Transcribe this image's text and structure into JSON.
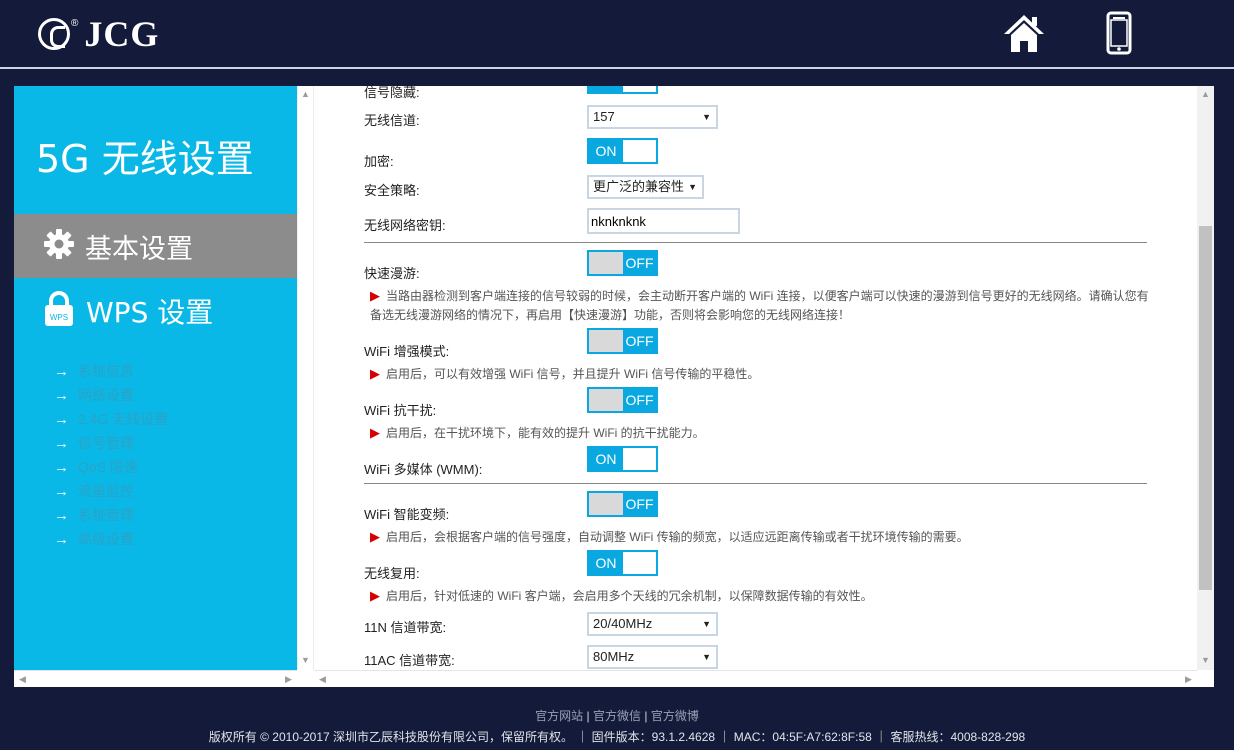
{
  "header": {
    "logo_text": "JCG",
    "logo_reg": "®",
    "home_icon": "home-icon",
    "mobile_icon": "mobile-phone-icon"
  },
  "sidebar": {
    "title": "5G 无线设置",
    "basic": {
      "label": "基本设置",
      "icon": "gear-icon"
    },
    "wps": {
      "label": "WPS 设置",
      "icon": "lock-icon",
      "icon_text": "WPS"
    },
    "links": [
      "系统信息",
      "网络设置",
      "2.4G 无线设置",
      "信号管理",
      "QoS 限速",
      "流量监控",
      "系统管理",
      "高级设置"
    ],
    "arrow": "→"
  },
  "content": {
    "partial_top_label": "信号隐藏:",
    "channel": {
      "label": "无线信道:",
      "value": "157"
    },
    "encrypt": {
      "label": "加密:",
      "state": "ON"
    },
    "security": {
      "label": "安全策略:",
      "value": "更广泛的兼容性"
    },
    "wifi_key": {
      "label": "无线网络密钥:",
      "value": "nknknknk"
    },
    "fast_roam": {
      "label": "快速漫游:",
      "state": "OFF",
      "note": "当路由器检测到客户端连接的信号较弱的时候，会主动断开客户端的 WiFi 连接，以便客户端可以快速的漫游到信号更好的无线网络。请确认您有备选无线漫游网络的情况下，再启用【快速漫游】功能，否则将会影响您的无线网络连接！"
    },
    "wifi_boost": {
      "label": "WiFi 增强模式:",
      "state": "OFF",
      "note": "启用后，可以有效增强 WiFi 信号，并且提升 WiFi 信号传输的平稳性。"
    },
    "wifi_anti": {
      "label": "WiFi 抗干扰:",
      "state": "OFF",
      "note": "启用后，在干扰环境下，能有效的提升 WiFi 的抗干扰能力。"
    },
    "wmm": {
      "label": "WiFi 多媒体 (WMM):",
      "state": "ON"
    },
    "smart_freq": {
      "label": "WiFi 智能变频:",
      "state": "OFF",
      "note": "启用后，会根据客户端的信号强度，自动调整 WiFi 传输的频宽，以适应远距离传输或者干扰环境传输的需要。"
    },
    "reuse": {
      "label": "无线复用:",
      "state": "ON",
      "note": "启用后，针对低速的 WiFi 客户端，会启用多个天线的冗余机制，以保障数据传输的有效性。"
    },
    "bw_11n": {
      "label": "11N 信道带宽:",
      "value": "20/40MHz"
    },
    "bw_11ac": {
      "label": "11AC 信道带宽:",
      "value": "80MHz"
    },
    "caret": "▼"
  },
  "footer": {
    "links": [
      "官方网站",
      "官方微信",
      "官方微博"
    ],
    "sep": "|",
    "copyright": "版权所有 © 2010-2017 深圳市乙辰科技股份有限公司，保留所有权。 ｜ 固件版本：93.1.2.4628 ｜ MAC：04:5F:A7:62:8F:58 ｜ 客服热线：4008-828-298"
  }
}
